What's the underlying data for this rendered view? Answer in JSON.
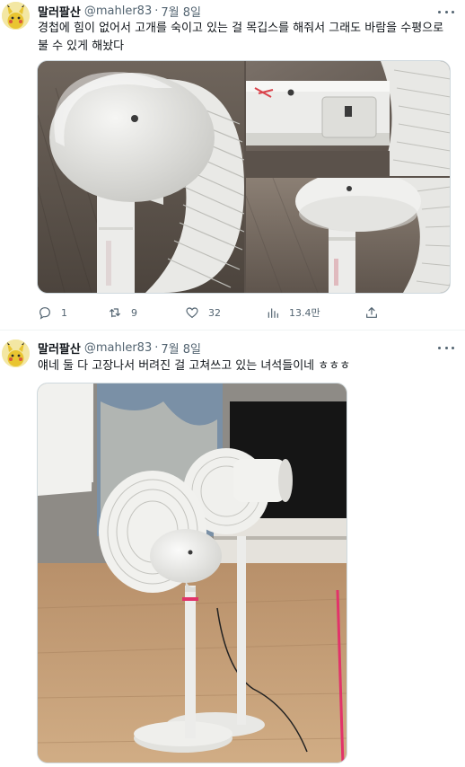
{
  "tweets": [
    {
      "author": {
        "name": "말러팔산",
        "handle": "@mahler83",
        "separator": "·",
        "date": "7월 8일"
      },
      "text": "경첩에 힘이 없어서 고개를 숙이고 있는 걸 목깁스를 해줘서 그래도 바람을 수평으로 불 수 있게 해놨다",
      "stats": {
        "replies": "1",
        "retweets": "9",
        "likes": "32",
        "views": "13.4만"
      },
      "icons": [
        "more-icon",
        "reply-icon",
        "retweet-icon",
        "like-icon",
        "views-icon",
        "share-icon"
      ]
    },
    {
      "author": {
        "name": "말러팔산",
        "handle": "@mahler83",
        "separator": "·",
        "date": "7월 8일"
      },
      "text": "얘네 둘 다 고장나서 버려진 걸 고쳐쓰고 있는 녀석들이네 ㅎㅎㅎ",
      "icons": [
        "more-icon"
      ]
    }
  ],
  "colors": {
    "text_primary": "#0f1419",
    "text_secondary": "#536471",
    "border": "#cfd9de"
  }
}
